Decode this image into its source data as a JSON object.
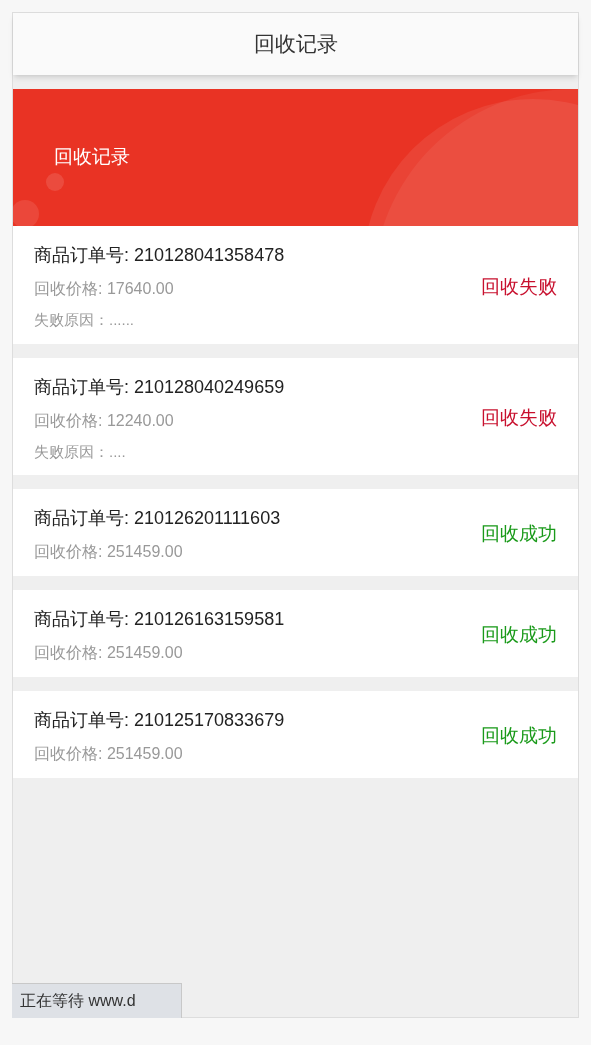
{
  "header": {
    "title": "回收记录"
  },
  "banner": {
    "title": "回收记录"
  },
  "records": [
    {
      "order": "商品订单号: 210128041358478",
      "price": "回收价格: 17640.00",
      "reason": "失败原因：......",
      "status": "回收失败",
      "kind": "failed"
    },
    {
      "order": "商品订单号: 210128040249659",
      "price": "回收价格: 12240.00",
      "reason": "失败原因：....",
      "status": "回收失败",
      "kind": "failed"
    },
    {
      "order": "商品订单号: 210126201111603",
      "price": "回收价格: 251459.00",
      "status": "回收成功",
      "kind": "success"
    },
    {
      "order": "商品订单号: 210126163159581",
      "price": "回收价格: 251459.00",
      "status": "回收成功",
      "kind": "success"
    },
    {
      "order": "商品订单号: 210125170833679",
      "price": "回收价格: 251459.00",
      "status": "回收成功",
      "kind": "success"
    }
  ],
  "status_bar": {
    "text": "正在等待 www.d"
  }
}
